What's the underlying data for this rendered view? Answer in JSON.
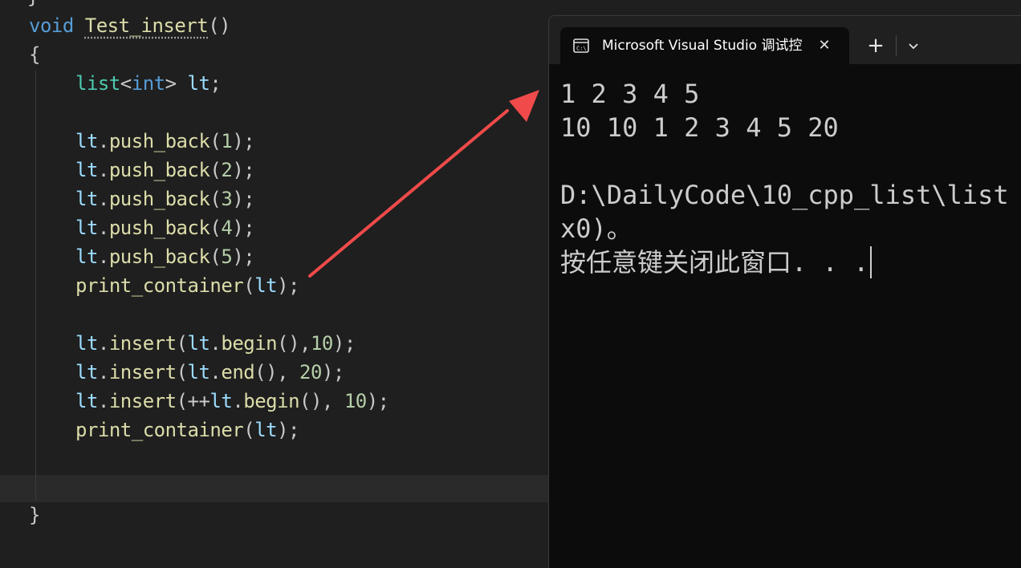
{
  "editor": {
    "brace_top": "}",
    "lines": [
      {
        "tokens": [
          {
            "c": "kw",
            "t": "void "
          },
          {
            "c": "fn squig",
            "t": "Test_insert"
          },
          {
            "c": "pl",
            "t": "()"
          }
        ]
      },
      {
        "tokens": [
          {
            "c": "pl",
            "t": "{"
          }
        ]
      },
      {
        "tokens": [
          {
            "c": "ty",
            "t": "list"
          },
          {
            "c": "pl",
            "t": "<"
          },
          {
            "c": "kw",
            "t": "int"
          },
          {
            "c": "pl",
            "t": "> "
          },
          {
            "c": "id",
            "t": "lt"
          },
          {
            "c": "pl",
            "t": ";"
          }
        ]
      },
      {
        "tokens": [
          {
            "c": "id",
            "t": "lt"
          },
          {
            "c": "pl",
            "t": "."
          },
          {
            "c": "fn",
            "t": "push_back"
          },
          {
            "c": "pl",
            "t": "("
          },
          {
            "c": "nm",
            "t": "1"
          },
          {
            "c": "pl",
            "t": ");"
          }
        ]
      },
      {
        "tokens": [
          {
            "c": "id",
            "t": "lt"
          },
          {
            "c": "pl",
            "t": "."
          },
          {
            "c": "fn",
            "t": "push_back"
          },
          {
            "c": "pl",
            "t": "("
          },
          {
            "c": "nm",
            "t": "2"
          },
          {
            "c": "pl",
            "t": ");"
          }
        ]
      },
      {
        "tokens": [
          {
            "c": "id",
            "t": "lt"
          },
          {
            "c": "pl",
            "t": "."
          },
          {
            "c": "fn",
            "t": "push_back"
          },
          {
            "c": "pl",
            "t": "("
          },
          {
            "c": "nm",
            "t": "3"
          },
          {
            "c": "pl",
            "t": ");"
          }
        ]
      },
      {
        "tokens": [
          {
            "c": "id",
            "t": "lt"
          },
          {
            "c": "pl",
            "t": "."
          },
          {
            "c": "fn",
            "t": "push_back"
          },
          {
            "c": "pl",
            "t": "("
          },
          {
            "c": "nm",
            "t": "4"
          },
          {
            "c": "pl",
            "t": ");"
          }
        ]
      },
      {
        "tokens": [
          {
            "c": "id",
            "t": "lt"
          },
          {
            "c": "pl",
            "t": "."
          },
          {
            "c": "fn",
            "t": "push_back"
          },
          {
            "c": "pl",
            "t": "("
          },
          {
            "c": "nm",
            "t": "5"
          },
          {
            "c": "pl",
            "t": ");"
          }
        ]
      },
      {
        "tokens": [
          {
            "c": "fn",
            "t": "print_container"
          },
          {
            "c": "pl",
            "t": "("
          },
          {
            "c": "id",
            "t": "lt"
          },
          {
            "c": "pl",
            "t": ");"
          }
        ]
      },
      {
        "tokens": [
          {
            "c": "id",
            "t": "lt"
          },
          {
            "c": "pl",
            "t": "."
          },
          {
            "c": "fn",
            "t": "insert"
          },
          {
            "c": "pl",
            "t": "("
          },
          {
            "c": "id",
            "t": "lt"
          },
          {
            "c": "pl",
            "t": "."
          },
          {
            "c": "fn",
            "t": "begin"
          },
          {
            "c": "pl",
            "t": "(),"
          },
          {
            "c": "nm",
            "t": "10"
          },
          {
            "c": "pl",
            "t": ");"
          }
        ]
      },
      {
        "tokens": [
          {
            "c": "id",
            "t": "lt"
          },
          {
            "c": "pl",
            "t": "."
          },
          {
            "c": "fn",
            "t": "insert"
          },
          {
            "c": "pl",
            "t": "("
          },
          {
            "c": "id",
            "t": "lt"
          },
          {
            "c": "pl",
            "t": "."
          },
          {
            "c": "fn",
            "t": "end"
          },
          {
            "c": "pl",
            "t": "(), "
          },
          {
            "c": "nm",
            "t": "20"
          },
          {
            "c": "pl",
            "t": ");"
          }
        ]
      },
      {
        "tokens": [
          {
            "c": "id",
            "t": "lt"
          },
          {
            "c": "pl",
            "t": "."
          },
          {
            "c": "fn",
            "t": "insert"
          },
          {
            "c": "pl",
            "t": "(++"
          },
          {
            "c": "id",
            "t": "lt"
          },
          {
            "c": "pl",
            "t": "."
          },
          {
            "c": "fn",
            "t": "begin"
          },
          {
            "c": "pl",
            "t": "(), "
          },
          {
            "c": "nm",
            "t": "10"
          },
          {
            "c": "pl",
            "t": ");"
          }
        ]
      },
      {
        "tokens": [
          {
            "c": "fn",
            "t": "print_container"
          },
          {
            "c": "pl",
            "t": "("
          },
          {
            "c": "id",
            "t": "lt"
          },
          {
            "c": "pl",
            "t": ");"
          }
        ]
      },
      {
        "tokens": [
          {
            "c": "pl",
            "t": "}"
          }
        ]
      }
    ]
  },
  "terminal": {
    "tab_title": "Microsoft Visual Studio 调试控制台",
    "tab_icon": "terminal-app-icon",
    "close_icon": "close-icon",
    "new_tab_label": "+",
    "dropdown_icon": "chevron-down-icon",
    "output_lines": [
      "1 2 3 4 5",
      "10 10 1 2 3 4 5 20",
      "",
      "D:\\DailyCode\\10_cpp_list\\list",
      "x0)。",
      "按任意键关闭此窗口. . ."
    ]
  },
  "colors": {
    "editor_bg": "#1f1f1f",
    "terminal_bg": "#0c0c0c",
    "arrow": "#f04a4a"
  }
}
